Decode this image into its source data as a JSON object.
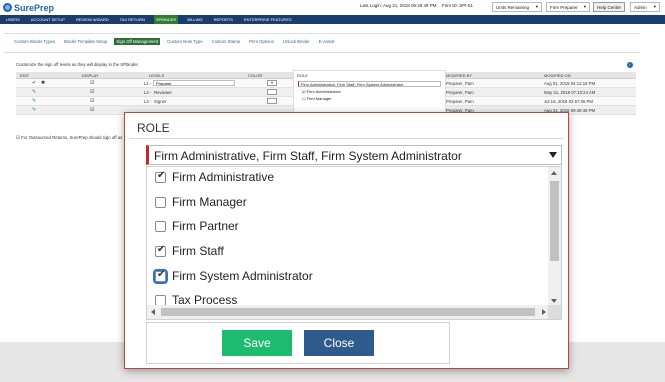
{
  "brand": {
    "logo_text": "SurePrep",
    "colors": {
      "nav": "#1a3d6e",
      "active_nav": "#2e7d32",
      "save": "#1dbb6e",
      "close": "#2d5b8e",
      "required": "#c62828"
    }
  },
  "header": {
    "last_login": "Last Login: Aug 21, 2018 06:26:49 PM",
    "firm_id": "Firm ID: SPI-51",
    "units_select": "Units Remaining",
    "role_select": "Firm Preparer",
    "help_button": "Help Center",
    "admin_select": "Admin"
  },
  "nav": {
    "items": [
      {
        "label": "USERS"
      },
      {
        "label": "ACCOUNT SETUP"
      },
      {
        "label": "REVIEW WIZARD"
      },
      {
        "label": "TAX RETURN"
      },
      {
        "label": "SPBINDER",
        "active": true
      },
      {
        "label": "BILLING"
      },
      {
        "label": "REPORTS"
      },
      {
        "label": "ENTERPRISE FEATURES"
      }
    ]
  },
  "subtabs": [
    {
      "label": "Custom Binder Types"
    },
    {
      "label": "Binder Template Setup"
    },
    {
      "label": "Sign Off Management",
      "active": true
    },
    {
      "label": "Custom Note Type"
    },
    {
      "label": "Custom Stamp"
    },
    {
      "label": "Print Options"
    },
    {
      "label": "Unlock Binder"
    },
    {
      "label": "E-Assist"
    }
  ],
  "hint": "Customize the sign off levels as they will display in the SPbinder.",
  "table": {
    "headers": {
      "edit": "EDIT",
      "display": "DISPLAY",
      "levels": "LEVELS",
      "color": "COLOR",
      "role": "ROLE",
      "modified_by": "MODIFIED BY",
      "modified_on": "MODIFIED ON"
    },
    "rows": [
      {
        "level_prefix": "L1 -",
        "level": "Preparer",
        "modified_by": "Preparer, Pam",
        "modified_on": "Aug 01, 2018 04:12:18 PM"
      },
      {
        "level_prefix": "L2 -",
        "level": "Reviewer",
        "modified_by": "Preparer, Pam",
        "modified_on": "May 31, 2018 07:10:24 AM"
      },
      {
        "level_prefix": "L3 -",
        "level": "Signer",
        "modified_by": "Preparer, Pam",
        "modified_on": "Jul 16, 2018 02:57:36 PM"
      },
      {
        "level_prefix": "",
        "level": "",
        "modified_by": "Preparer, Pam",
        "modified_on": "Aug 21, 2018 09:48:48 PM"
      }
    ]
  },
  "footnote": "For Outsourced Returns, SurePrep should sign off as",
  "bg_role": {
    "title": "ROLE",
    "select_value": "Firm Administrative, Firm Staff, Firm System Administrator",
    "items": [
      "Firm Administrative",
      "Firm Manager"
    ]
  },
  "modal": {
    "title": "ROLE",
    "select_value": "Firm Administrative, Firm Staff, Firm System Administrator",
    "options": [
      {
        "label": "Firm Administrative",
        "checked": true
      },
      {
        "label": "Firm Manager",
        "checked": false
      },
      {
        "label": "Firm Partner",
        "checked": false
      },
      {
        "label": "Firm Staff",
        "checked": true
      },
      {
        "label": "Firm System Administrator",
        "checked": true,
        "focused": true
      },
      {
        "label": "Tax Process",
        "checked": false
      }
    ],
    "save_label": "Save",
    "close_label": "Close"
  }
}
